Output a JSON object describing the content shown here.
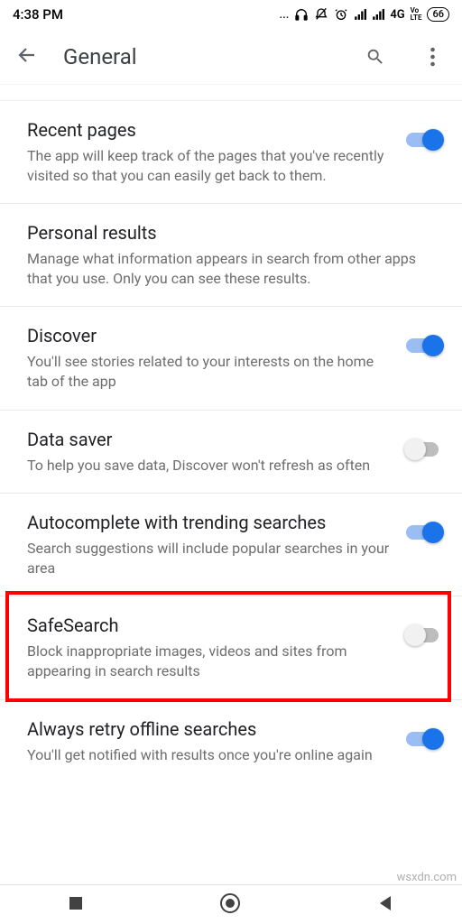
{
  "status": {
    "time": "4:38 PM",
    "dots": "...",
    "network_label": "4G",
    "volte_label": "Vo\nLTE",
    "battery": "66"
  },
  "appbar": {
    "title": "General"
  },
  "settings": [
    {
      "key": "recent-pages",
      "title": "Recent pages",
      "desc": "The app will keep track of the pages that you've recently visited so that you can easily get back to them.",
      "toggle": "on"
    },
    {
      "key": "personal-results",
      "title": "Personal results",
      "desc": "Manage what information appears in search from other apps that you use. Only you can see these results.",
      "toggle": null
    },
    {
      "key": "discover",
      "title": "Discover",
      "desc": "You'll see stories related to your interests on the home tab of the app",
      "toggle": "on"
    },
    {
      "key": "data-saver",
      "title": "Data saver",
      "desc": "To help you save data, Discover won't refresh as often",
      "toggle": "off"
    },
    {
      "key": "autocomplete-trending",
      "title": "Autocomplete with trending searches",
      "desc": "Search suggestions will include popular searches in your area",
      "toggle": "on"
    },
    {
      "key": "safesearch",
      "title": "SafeSearch",
      "desc": "Block inappropriate images, videos and sites from appearing in search results",
      "toggle": "off",
      "highlighted": true
    },
    {
      "key": "retry-offline",
      "title": "Always retry offline searches",
      "desc": "You'll get notified with results once you're online again",
      "toggle": "on"
    }
  ],
  "watermark": "wsxdn.com"
}
